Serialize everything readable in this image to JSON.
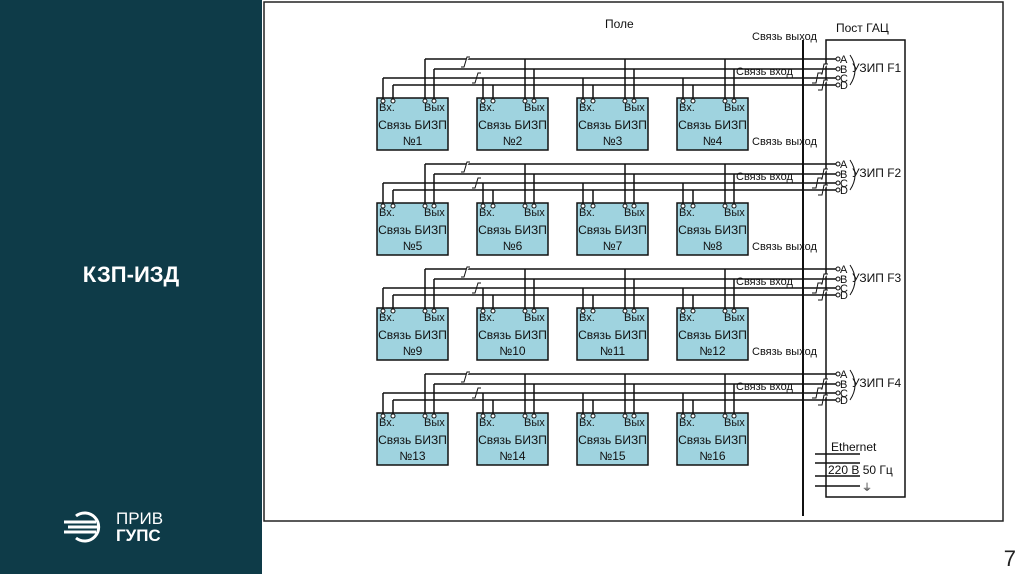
{
  "sidebar": {
    "title": "КЗП-ИЗД",
    "logo": {
      "line1": "ПРИВ",
      "line2": "ГУПС"
    }
  },
  "page_number": "7",
  "diagram": {
    "field_label": "Поле",
    "post_label": "Пост ГАЦ",
    "block_in_label": "Вх.",
    "block_out_label": "Вых",
    "block_name": "Связь БИЗП",
    "link_out_label": "Связь выход",
    "link_in_label": "Связь вход",
    "terminals": [
      "A",
      "B",
      "C",
      "D"
    ],
    "rows": [
      {
        "uzip": "УЗИП F1",
        "blocks": [
          "№1",
          "№2",
          "№3",
          "№4"
        ]
      },
      {
        "uzip": "УЗИП F2",
        "blocks": [
          "№5",
          "№6",
          "№7",
          "№8"
        ]
      },
      {
        "uzip": "УЗИП F3",
        "blocks": [
          "№9",
          "№10",
          "№11",
          "№12"
        ]
      },
      {
        "uzip": "УЗИП F4",
        "blocks": [
          "№13",
          "№14",
          "№15",
          "№16"
        ]
      }
    ],
    "ethernet_label": "Ethernet",
    "power_label": "220 В 50 Гц",
    "ground_symbol": "⏚",
    "block_color": "#9fd3df",
    "sidebar_color": "#0e3b48"
  }
}
